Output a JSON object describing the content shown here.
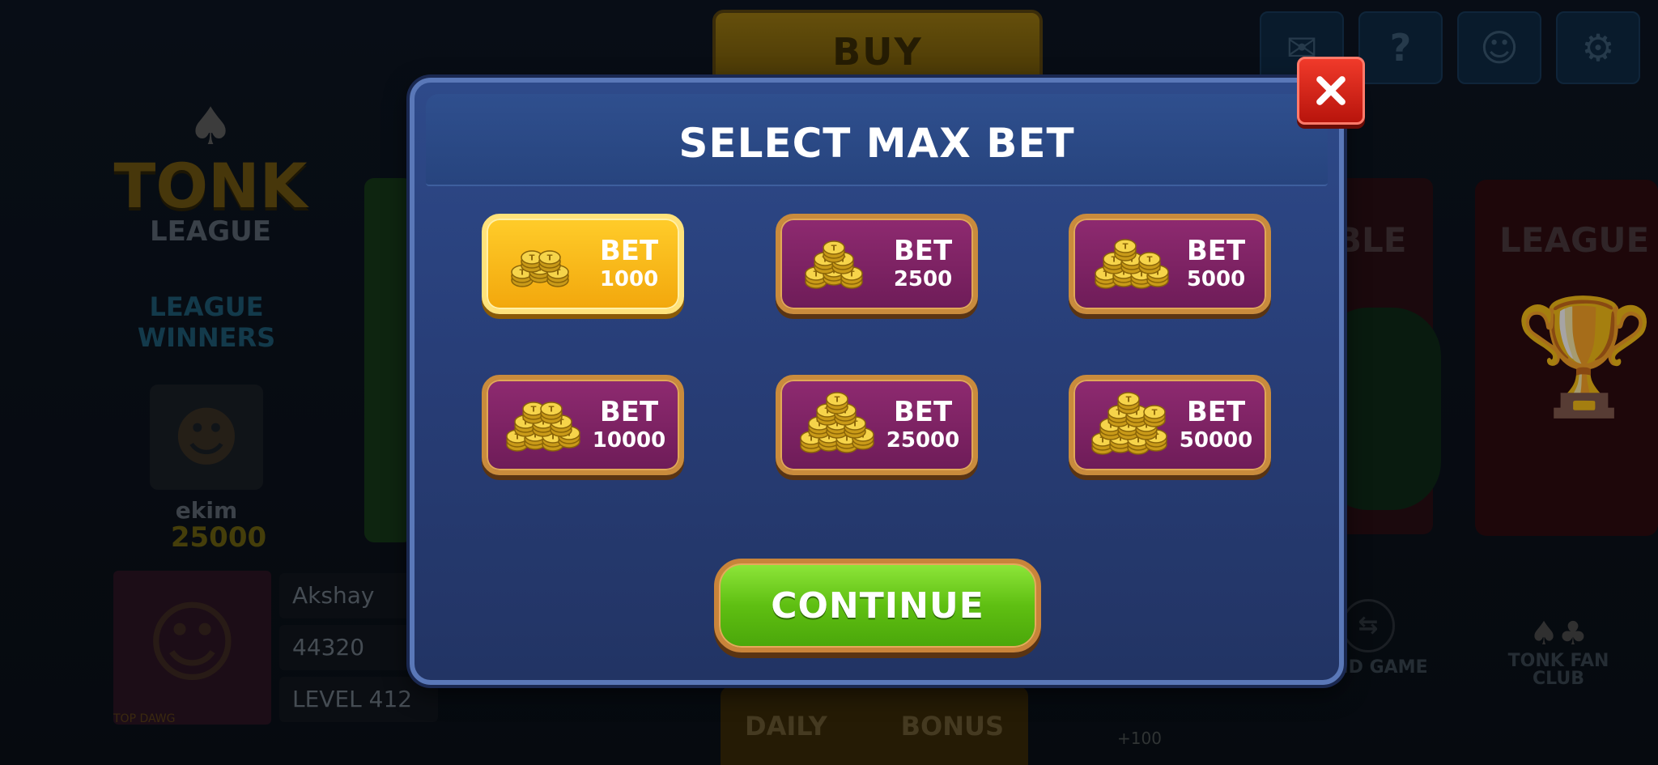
{
  "background": {
    "buy_label": "BUY",
    "top_icons": [
      "mail-icon",
      "help-icon",
      "support-icon",
      "settings-icon"
    ],
    "logo_title": "TONK",
    "logo_subtitle": "LEAGUE",
    "league_winners": "LEAGUE WINNERS",
    "winner_name": "ekim",
    "winner_coins": "25000",
    "table_label": "BLE",
    "league_label": "LEAGUE C",
    "player": {
      "name": "Akshay",
      "coins": "44320",
      "level": "LEVEL 412",
      "badge": "TOP DAWG"
    },
    "daily_label": "DAILY",
    "bonus_label": "BONUS",
    "send_game": "SEND GAME",
    "fan_club": "TONK FAN CLUB",
    "plus_coins": "+100"
  },
  "modal": {
    "title": "SELECT MAX BET",
    "close_icon": "close-icon",
    "selected_index": 0,
    "bets": [
      {
        "label": "BET",
        "value": "1000"
      },
      {
        "label": "BET",
        "value": "2500"
      },
      {
        "label": "BET",
        "value": "5000"
      },
      {
        "label": "BET",
        "value": "10000"
      },
      {
        "label": "BET",
        "value": "25000"
      },
      {
        "label": "BET",
        "value": "50000"
      }
    ],
    "continue_label": "CONTINUE"
  },
  "colors": {
    "modal_blue": "#2e4a8a",
    "selected_gold": "#f2a70c",
    "bet_purple": "#7e2264",
    "continue_green": "#5fbf12",
    "close_red": "#d82418"
  }
}
